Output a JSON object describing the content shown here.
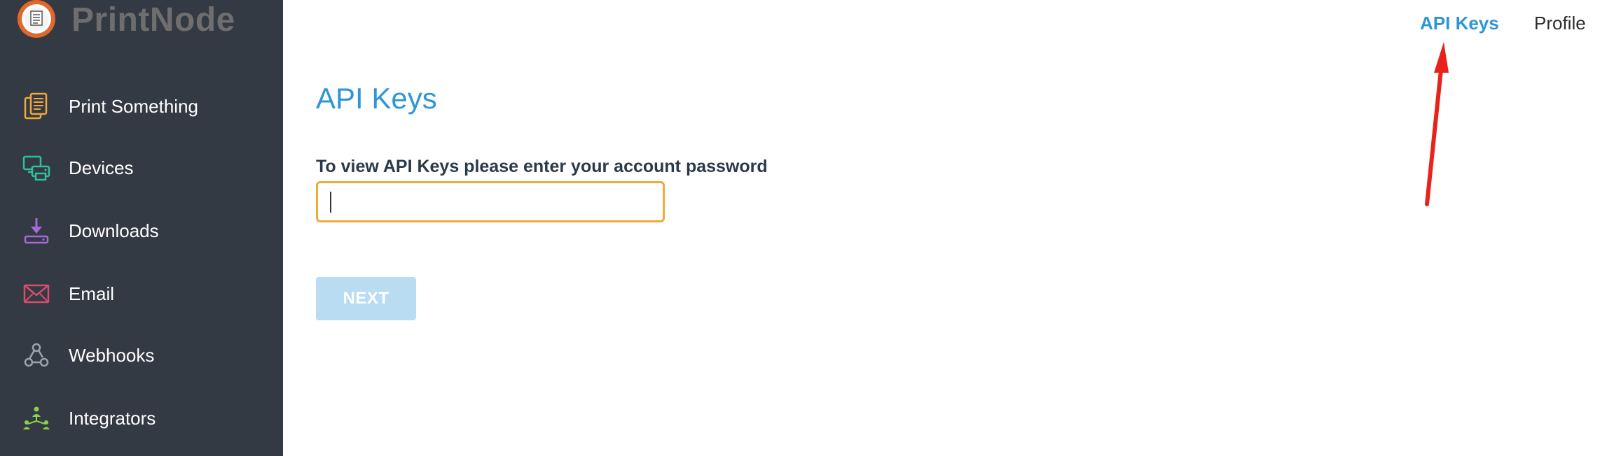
{
  "brand": {
    "name": "PrintNode",
    "logo_icon": "printnode-logo-icon"
  },
  "sidebar": {
    "items": [
      {
        "label": "Print Something",
        "icon": "document-stack-icon",
        "color": "#f0a93b"
      },
      {
        "label": "Devices",
        "icon": "printer-icon",
        "color": "#2ebf9f"
      },
      {
        "label": "Downloads",
        "icon": "download-icon",
        "color": "#a66ad6"
      },
      {
        "label": "Email",
        "icon": "envelope-icon",
        "color": "#d64d6e"
      },
      {
        "label": "Webhooks",
        "icon": "webhook-icon",
        "color": "#9aa3ad"
      },
      {
        "label": "Integrators",
        "icon": "integrators-icon",
        "color": "#8ed14b"
      }
    ]
  },
  "topnav": {
    "api_keys": "API Keys",
    "profile": "Profile"
  },
  "main": {
    "title": "API Keys",
    "password_label": "To view API Keys please enter your account password",
    "password_value": "",
    "next_label": "NEXT"
  },
  "colors": {
    "accent": "#2f96d6",
    "sidebar_bg": "#343a43",
    "input_focus": "#f0a93b",
    "button_disabled": "#b9dcf3",
    "annotation_arrow": "#e8231b"
  }
}
